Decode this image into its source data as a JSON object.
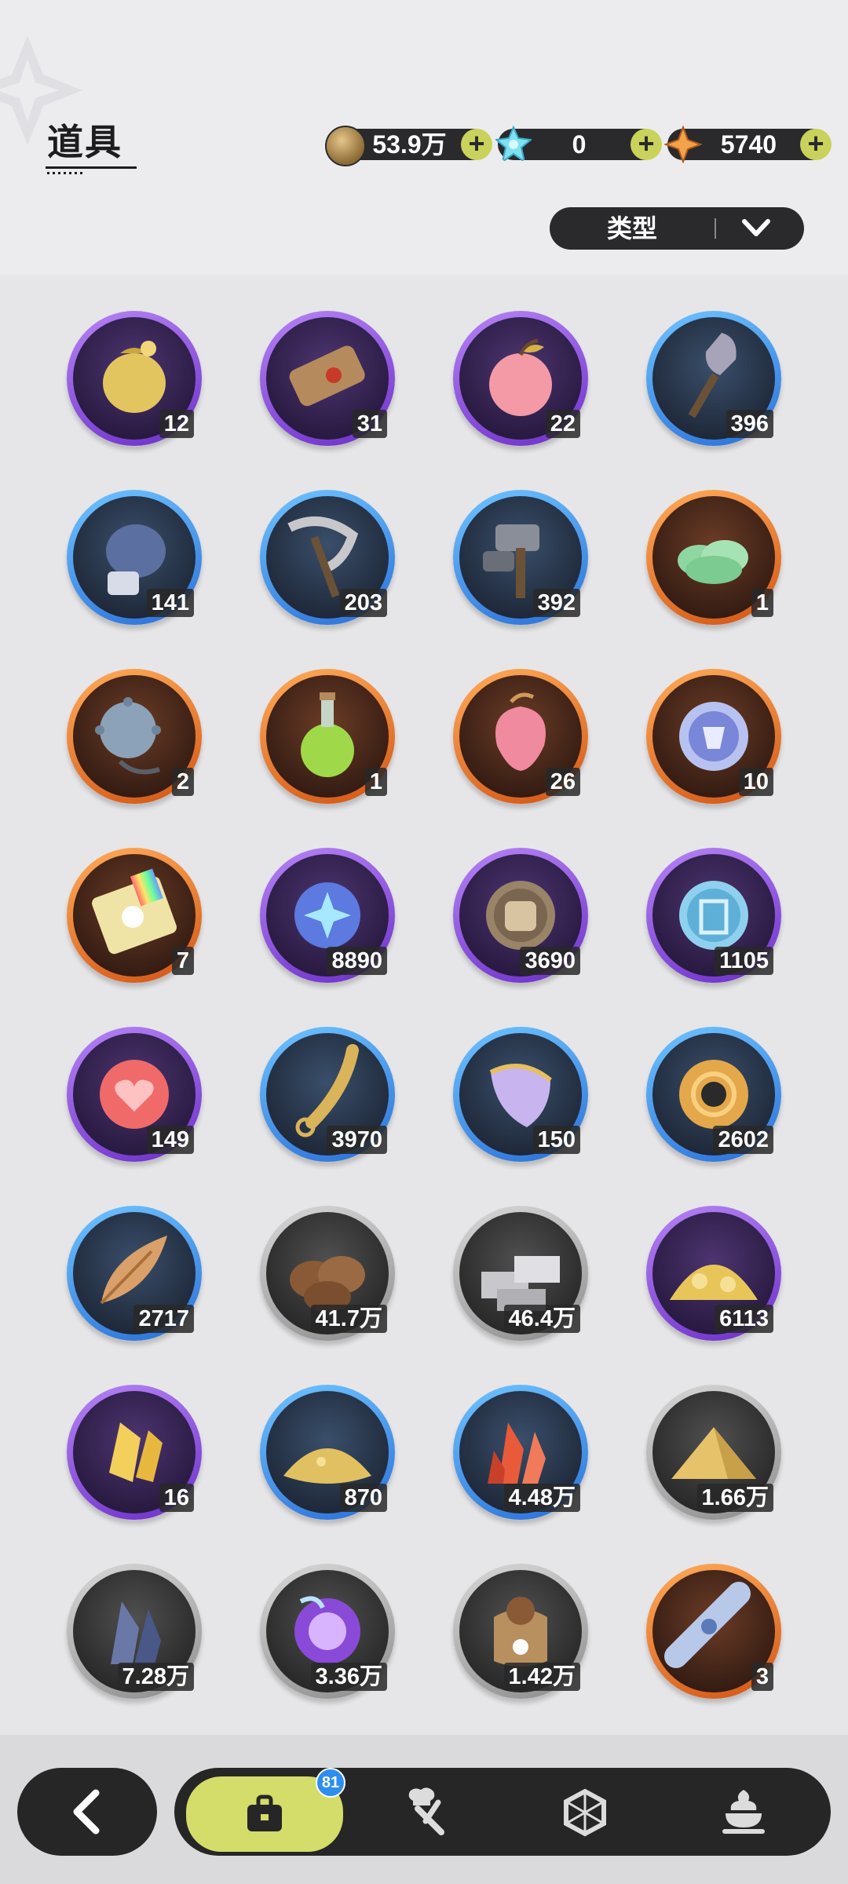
{
  "header": {
    "title": "道具",
    "currencies": [
      {
        "name": "coin-icon",
        "value": "53.9万",
        "plus": "+"
      },
      {
        "name": "crystal-icon",
        "value": "0",
        "plus": "+"
      },
      {
        "name": "star-icon",
        "value": "5740",
        "plus": "+"
      }
    ],
    "filter_label": "类型"
  },
  "items": [
    {
      "icon": "golden-helmet-icon",
      "count": "12"
    },
    {
      "icon": "scroll-icon",
      "count": "31"
    },
    {
      "icon": "pink-apple-icon",
      "count": "22"
    },
    {
      "icon": "shovel-icon",
      "count": "396"
    },
    {
      "icon": "boxing-glove-icon",
      "count": "141"
    },
    {
      "icon": "pickaxe-icon",
      "count": "203"
    },
    {
      "icon": "hammer-icon",
      "count": "392"
    },
    {
      "icon": "green-cloud-icon",
      "count": "1"
    },
    {
      "icon": "spiked-mine-icon",
      "count": "2"
    },
    {
      "icon": "potion-bottle-icon",
      "count": "1"
    },
    {
      "icon": "crystal-peach-icon",
      "count": "26"
    },
    {
      "icon": "shirt-coin-icon",
      "count": "10"
    },
    {
      "icon": "rainbow-ticket-icon",
      "count": "7"
    },
    {
      "icon": "star-orb-icon",
      "count": "8890"
    },
    {
      "icon": "fist-coin-icon",
      "count": "3690"
    },
    {
      "icon": "blue-emblem-coin-icon",
      "count": "1105"
    },
    {
      "icon": "heart-coin-icon",
      "count": "149"
    },
    {
      "icon": "golden-blade-icon",
      "count": "3970"
    },
    {
      "icon": "scale-shield-icon",
      "count": "150"
    },
    {
      "icon": "gear-coin-icon",
      "count": "2602"
    },
    {
      "icon": "leaf-icon",
      "count": "2717"
    },
    {
      "icon": "wood-logs-icon",
      "count": "41.7万"
    },
    {
      "icon": "stone-bricks-icon",
      "count": "46.4万"
    },
    {
      "icon": "gold-ore-pile-icon",
      "count": "6113"
    },
    {
      "icon": "gold-crystal-icon",
      "count": "16"
    },
    {
      "icon": "gold-sand-icon",
      "count": "870"
    },
    {
      "icon": "red-crystal-icon",
      "count": "4.48万"
    },
    {
      "icon": "sand-pile-icon",
      "count": "1.66万"
    },
    {
      "icon": "dark-crystal-icon",
      "count": "7.28万"
    },
    {
      "icon": "purple-orb-icon",
      "count": "3.36万"
    },
    {
      "icon": "paw-sack-icon",
      "count": "1.42万"
    },
    {
      "icon": "cloth-bundle-icon",
      "count": "3"
    }
  ],
  "bottom": {
    "badge": "81",
    "tabs": [
      "bag-icon",
      "chef-knife-icon",
      "hexagon-icon",
      "pudding-icon"
    ]
  },
  "colors": {
    "accent": "#d4dc6a",
    "badge": "#2d8ef0",
    "purple": "#8b4fe0",
    "blue": "#3b8ae8",
    "orange": "#e8742a",
    "gray": "#b0b0b0"
  }
}
